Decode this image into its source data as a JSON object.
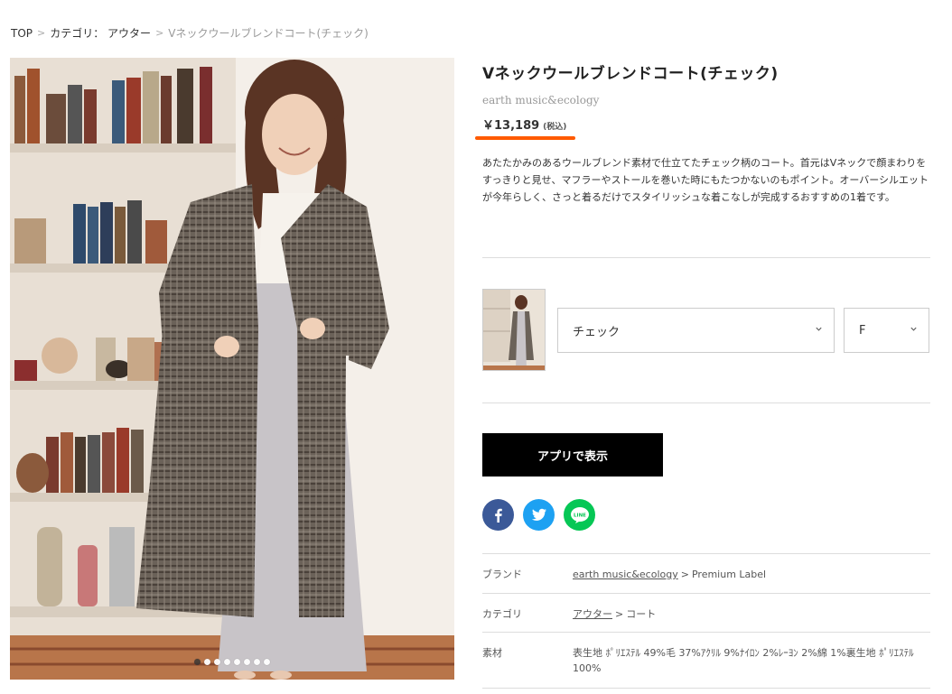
{
  "breadcrumb": {
    "top": "TOP",
    "sep": ">",
    "category": "カテゴリ： アウター",
    "current": "Vネックウールブレンドコート(チェック)"
  },
  "product": {
    "title": "Vネックウールブレンドコート(チェック)",
    "brand": "earth music&ecology",
    "price": "￥13,189",
    "tax": "(税込)",
    "description": "あたたかみのあるウールブレンド素材で仕立てたチェック柄のコート。首元はVネックで顔まわりをすっきりと見せ、マフラーやストールを巻いた時にもたつかないのもポイント。オーバーシルエットが今年らしく、さっと着るだけでスタイリッシュな着こなしが完成するおすすめの1着です。"
  },
  "gallery": {
    "dot_count": 8,
    "active_index": 0
  },
  "variants": {
    "color_selected": "チェック",
    "size_selected": "F"
  },
  "actions": {
    "app_button": "アプリで表示"
  },
  "social": {
    "facebook_icon": "facebook-icon",
    "twitter_icon": "twitter-icon",
    "line_icon": "line-icon",
    "line_text": "LINE"
  },
  "spec": {
    "brand_label": "ブランド",
    "brand_link": "earth music&ecology",
    "brand_sub": "Premium Label",
    "category_label": "カテゴリ",
    "category_link": "アウター",
    "category_sub": "コート",
    "material_label": "素材",
    "material_value": "表生地 ﾎﾟﾘｴｽﾃﾙ 49%毛 37%ｱｸﾘﾙ 9%ﾅｲﾛﾝ 2%ﾚｰﾖﾝ 2%綿 1%裏生地 ﾎﾟﾘｴｽﾃﾙ 100%",
    "gt": ">"
  },
  "colors": {
    "accent_underline": "#ff5a00",
    "facebook": "#3b5998",
    "twitter": "#1da1f2",
    "line": "#06c755"
  }
}
